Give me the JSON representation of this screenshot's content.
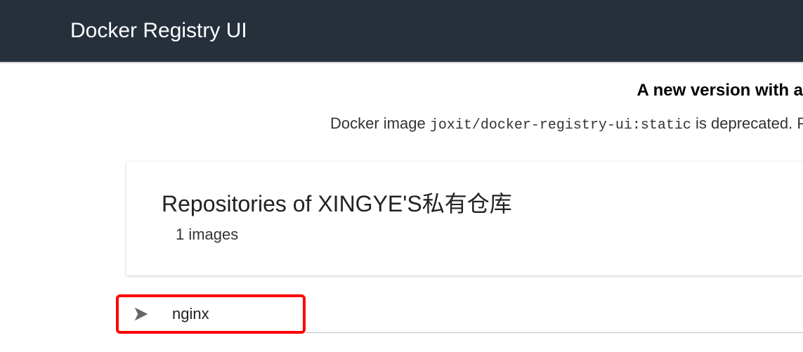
{
  "header": {
    "title": "Docker Registry UI"
  },
  "banner": {
    "headline": "A new version with a",
    "desc_pre": "Docker image ",
    "desc_code": "joxit/docker-registry-ui:static",
    "desc_post": " is deprecated. Plea"
  },
  "card": {
    "title": "Repositories of XINGYE'S私有仓库",
    "subtitle": "1 images"
  },
  "list": {
    "items": [
      {
        "name": "nginx"
      }
    ]
  }
}
